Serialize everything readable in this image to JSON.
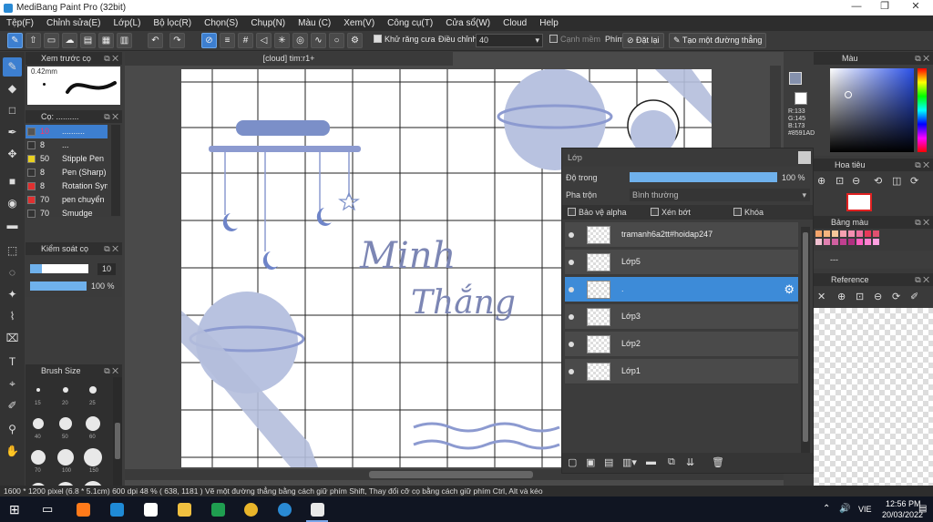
{
  "window": {
    "title": "MediBang Paint Pro (32bit)"
  },
  "menu": [
    "Tệp(F)",
    "Chỉnh sửa(E)",
    "Lớp(L)",
    "Bộ lọc(R)",
    "Chọn(S)",
    "Chụp(N)",
    "Màu (C)",
    "Xem(V)",
    "Công cụ(T)",
    "Cửa sổ(W)",
    "Cloud",
    "Help"
  ],
  "toolbar": {
    "antialias_label": "Khử răng cưa",
    "adjust_label": "Điều chỉnh",
    "adjust_value": "40",
    "sharp_label": "Cạnh mềm",
    "key_label": "Phím",
    "reset_label": "Đặt lại",
    "straight_line_label": "Tạo một đường thẳng"
  },
  "preview_panel": {
    "title": "Xem trước cọ",
    "size": "0.42mm"
  },
  "brush_panel": {
    "title": "Cọ: ..........",
    "items": [
      {
        "size": "10",
        "name": "..........",
        "color": "#555555",
        "selected": true
      },
      {
        "size": "8",
        "name": "...",
        "color": "#333333",
        "selected": false
      },
      {
        "size": "50",
        "name": "Stipple Pen",
        "color": "#e8d020",
        "selected": false
      },
      {
        "size": "8",
        "name": "Pen (Sharp)",
        "color": "#333333",
        "selected": false
      },
      {
        "size": "8",
        "name": "Rotation Sym",
        "color": "#e03030",
        "selected": false
      },
      {
        "size": "70",
        "name": "pen chuyển",
        "color": "#e03030",
        "selected": false
      },
      {
        "size": "70",
        "name": "Smudge",
        "color": "#333333",
        "selected": false
      }
    ]
  },
  "brush_control": {
    "title": "Kiểm soát cọ",
    "size": "10",
    "opacity": "100 %",
    "size_fraction": 0.2,
    "opacity_fraction": 1.0
  },
  "brush_size": {
    "title": "Brush Size",
    "row_labels": [
      [
        "15",
        "20",
        "25"
      ],
      [
        "40",
        "50",
        "60"
      ],
      [
        "70",
        "100",
        "150"
      ],
      [
        "",
        "",
        ""
      ]
    ]
  },
  "document": {
    "tab": "[cloud] tim:r1+"
  },
  "artwork": {
    "text_line1": "Minh",
    "text_line2": "Thắng"
  },
  "layer_panel": {
    "title": "Lớp",
    "opacity_label": "Độ trong",
    "opacity_value": "100 %",
    "opacity_fraction": 1.0,
    "blend_label": "Pha trộn",
    "blend_value": "Bình thường",
    "protect_alpha": "Bảo vệ alpha",
    "clip": "Xén bớt",
    "lock": "Khóa",
    "layers": [
      {
        "name": "tramanh6a2tt#hoidap247",
        "selected": false
      },
      {
        "name": "Lớp5",
        "selected": false
      },
      {
        "name": ".",
        "selected": true
      },
      {
        "name": "Lớp3",
        "selected": false
      },
      {
        "name": "Lớp2",
        "selected": false
      },
      {
        "name": "Lớp1",
        "selected": false
      }
    ]
  },
  "color_panel": {
    "title": "Màu",
    "r": "R:133",
    "g": "G:145",
    "b": "B:173",
    "hex": "#8591AD",
    "color": "#8591ad"
  },
  "navigator": {
    "title": "Hoa tiêu"
  },
  "palette": {
    "title": "Bảng màu",
    "colors": [
      "#f4a46a",
      "#f7b47e",
      "#f6c79a",
      "#f7a0b0",
      "#f48fb1",
      "#ee6fa0",
      "#e8385a",
      "#e05070",
      "#f0c0d0",
      "#e080b0",
      "#d060a0",
      "#c04090",
      "#b03080",
      "#ff60c0",
      "#ff80d0",
      "#ffa0e0"
    ]
  },
  "reference": {
    "title": "Reference"
  },
  "status": {
    "text": "1600 * 1200 pixel   (6.8 * 5.1cm)   600 dpi   48 %   ( 638, 1181 )   Vẽ một đường thẳng bằng cách giữ phím Shift, Thay đổi cỡ cọ bằng cách giữ phím Ctrl, Alt và kéo"
  },
  "taskbar": {
    "time": "12:56 PM",
    "date": "20/03/2022",
    "lang": "VIE"
  }
}
